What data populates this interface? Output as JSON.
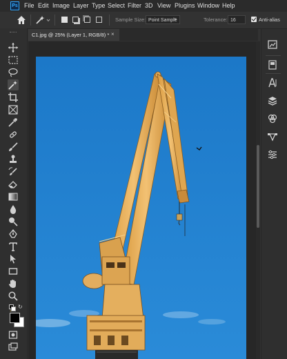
{
  "app": {
    "logo": "Ps"
  },
  "menu": [
    "File",
    "Edit",
    "Image",
    "Layer",
    "Type",
    "Select",
    "Filter",
    "3D",
    "View",
    "Plugins",
    "Window",
    "Help"
  ],
  "options": {
    "sample_size_label": "Sample Size:",
    "sample_size_value": "Point Sample",
    "tolerance_label": "Tolerance:",
    "tolerance_value": "16",
    "antialias_label": "Anti-alias",
    "antialias_checked": true
  },
  "document": {
    "tab_title": "C1.jpg @ 25% (Layer 1, RGB/8) *",
    "close_glyph": "×"
  },
  "tools": [
    "move-icon",
    "rectangular-marquee-icon",
    "lasso-icon",
    "magic-wand-icon",
    "crop-icon",
    "frame-icon",
    "eyedropper-icon",
    "spot-healing-icon",
    "brush-icon",
    "clone-stamp-icon",
    "history-brush-icon",
    "eraser-icon",
    "gradient-icon",
    "blur-icon",
    "dodge-icon",
    "pen-icon",
    "type-icon",
    "path-selection-icon",
    "rectangle-shape-icon",
    "hand-icon",
    "zoom-icon",
    "edit-toolbar-icon",
    "swap-colors-icon",
    "foreground-color",
    "quick-mask-icon",
    "screen-mode-icon"
  ],
  "right_panel": [
    "libraries-icon",
    "adjustments-icon",
    "character-icon",
    "layers-icon",
    "channels-icon",
    "paths-icon",
    "properties-icon"
  ],
  "colors": {
    "foreground": "#000000",
    "background": "#ffffff",
    "sky": "#1f7fd0",
    "crane": "#e9b25a"
  }
}
